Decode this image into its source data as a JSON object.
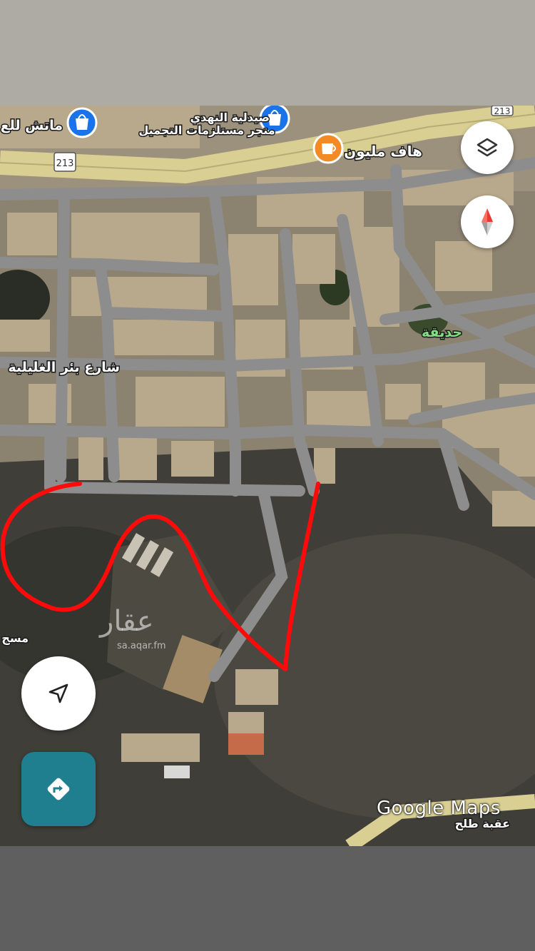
{
  "map": {
    "labels": {
      "pharmacy": "صيدلية النهدي",
      "cosmetics_store": "متجر مستلزمات التجميل",
      "shop_left": "ماتش للع",
      "cafe": "هاف مليون",
      "park": "حديقة",
      "street": "شارع بئر الغليلية",
      "mosque": "مسج",
      "road_bottom": "عقبة طلح"
    },
    "route_shields": [
      "213",
      "213"
    ],
    "attribution": "Google Maps"
  },
  "watermark": {
    "arabic": "عقار",
    "url": "sa.aqar.fm"
  },
  "controls": {
    "layers": "layers-icon",
    "compass": "compass-icon",
    "my_location": "navigation-arrow-icon",
    "directions": "directions-icon"
  },
  "colors": {
    "highway": "#d9cf93",
    "roads": "#8d8d8d",
    "boundary": "#ff0a0a",
    "pin_blue": "#1a73e8",
    "pin_orange": "#f28b25",
    "directions_button": "#1f7f8f",
    "park_label": "#7fe07f"
  }
}
